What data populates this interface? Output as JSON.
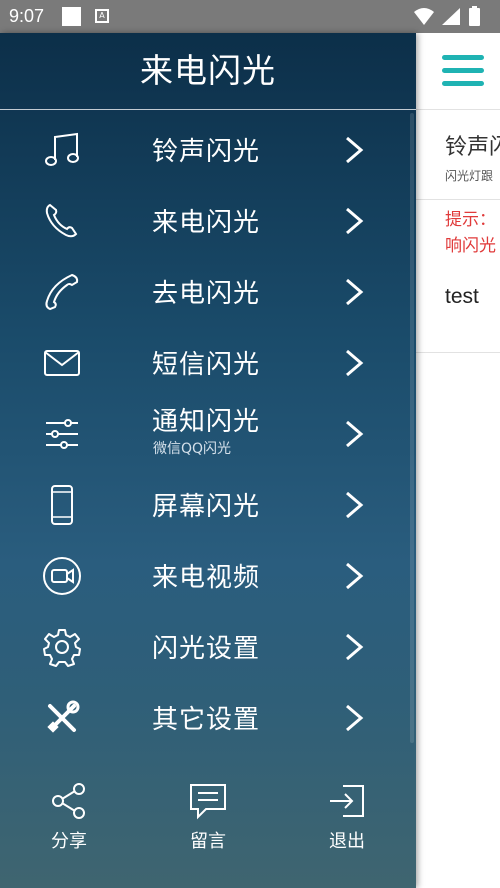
{
  "status_bar": {
    "time": "9:07"
  },
  "drawer": {
    "title": "来电闪光",
    "items": [
      {
        "label": "铃声闪光",
        "icon": "music-note-icon"
      },
      {
        "label": "来电闪光",
        "icon": "phone-icon"
      },
      {
        "label": "去电闪光",
        "icon": "outgoing-phone-icon"
      },
      {
        "label": "短信闪光",
        "icon": "envelope-icon"
      },
      {
        "label": "通知闪光",
        "sublabel": "微信QQ闪光",
        "icon": "sliders-icon"
      },
      {
        "label": "屏幕闪光",
        "icon": "smartphone-icon"
      },
      {
        "label": "来电视频",
        "icon": "video-call-icon"
      },
      {
        "label": "闪光设置",
        "icon": "gear-icon"
      },
      {
        "label": "其它设置",
        "icon": "tools-icon"
      }
    ],
    "bottom": {
      "share": "分享",
      "message": "留言",
      "exit": "退出"
    }
  },
  "content": {
    "title": "铃声闪",
    "subtitle": "闪光灯跟",
    "tip_line1": "提示：",
    "tip_line2": "响闪光",
    "test_text": "test"
  },
  "colors": {
    "accent": "#1fb3b3",
    "tip": "#e03a3a",
    "drawer_top": "#0c2f49",
    "drawer_bottom": "#3f6570"
  }
}
